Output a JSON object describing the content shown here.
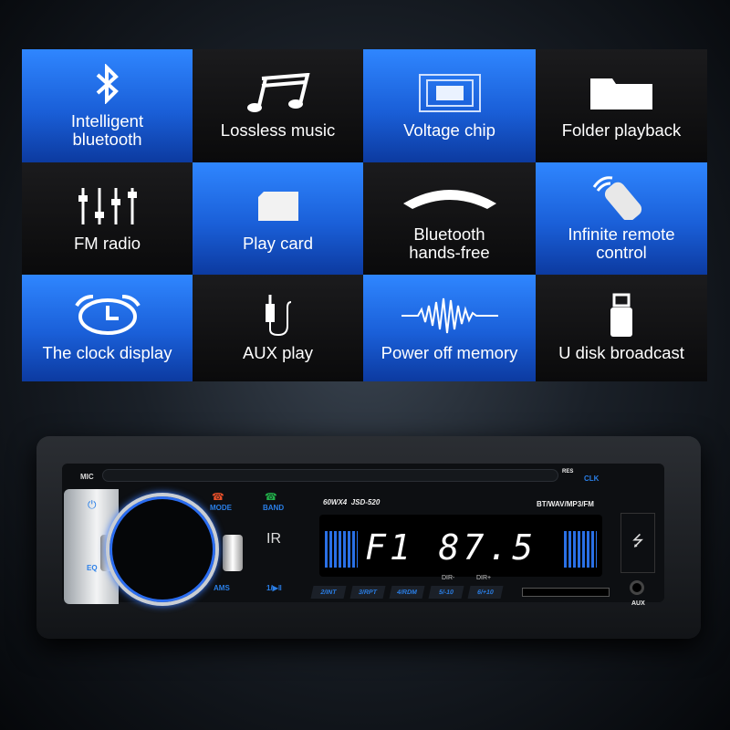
{
  "features": [
    {
      "label": "Intelligent bluetooth",
      "icon": "bluetooth-icon",
      "theme": "blue"
    },
    {
      "label": "Lossless music",
      "icon": "music-note-icon",
      "theme": "black"
    },
    {
      "label": "Voltage chip",
      "icon": "chip-icon",
      "theme": "blue"
    },
    {
      "label": "Folder playback",
      "icon": "folder-icon",
      "theme": "black"
    },
    {
      "label": "FM radio",
      "icon": "equalizer-sliders-icon",
      "theme": "black"
    },
    {
      "label": "Play card",
      "icon": "sd-card-icon",
      "theme": "blue"
    },
    {
      "label": "Bluetooth hands-free",
      "icon": "phone-handset-icon",
      "theme": "black"
    },
    {
      "label": "Infinite remote control",
      "icon": "remote-control-icon",
      "theme": "blue"
    },
    {
      "label": "The clock display",
      "icon": "alarm-clock-icon",
      "theme": "blue"
    },
    {
      "label": "AUX play",
      "icon": "aux-cable-icon",
      "theme": "black"
    },
    {
      "label": "Power off memory",
      "icon": "sound-wave-icon",
      "theme": "blue"
    },
    {
      "label": "U disk broadcast",
      "icon": "usb-drive-icon",
      "theme": "black"
    }
  ],
  "radio": {
    "mic": "MIC",
    "mode": "MODE",
    "band": "BAND",
    "eq": "EQ",
    "ams": "AMS",
    "play": "1/▶‖",
    "model_power": "60WX4",
    "model": "JSD-520",
    "formats": "BT/WAV/MP3/FM",
    "display": "F1  87.5",
    "res": "RES",
    "clk": "CLK",
    "aux": "AUX",
    "presets": [
      "2/INT",
      "3/RPT",
      "4/RDM",
      "5/-10",
      "6/+10"
    ],
    "dir_minus": "DIR-",
    "dir_plus": "DIR+",
    "colors": {
      "accent": "#2a7fe8",
      "mode": "#e8502a",
      "band": "#22b04a"
    }
  }
}
